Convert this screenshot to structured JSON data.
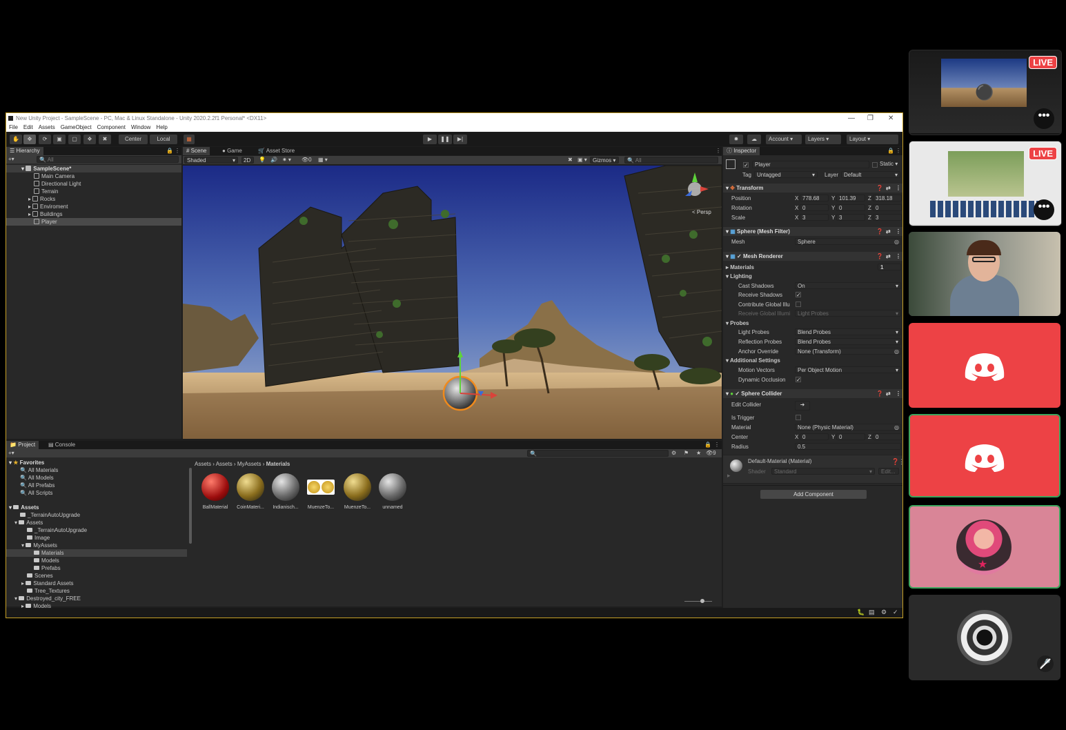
{
  "window": {
    "title": "New Unity Project - SampleScene - PC, Mac & Linux Standalone - Unity 2020.2.2f1 Personal* <DX11>",
    "menu": [
      "File",
      "Edit",
      "Assets",
      "GameObject",
      "Component",
      "Window",
      "Help"
    ]
  },
  "toolbar": {
    "pivot": "Center",
    "space": "Local",
    "account": "Account",
    "layers": "Layers",
    "layout": "Layout"
  },
  "hierarchy": {
    "tab": "Hierarchy",
    "search_placeholder": "All",
    "scene": "SampleScene*",
    "items": [
      "Main Camera",
      "Directional Light",
      "Terrain",
      "Rocks",
      "Enviroment",
      "Buildings",
      "Player"
    ]
  },
  "scene_view": {
    "tabs": [
      "Scene",
      "Game",
      "Asset Store"
    ],
    "shading": "Shaded",
    "mode_2d": "2D",
    "hidden_count": "0",
    "gizmos": "Gizmos",
    "search_placeholder": "All",
    "persp": "< Persp"
  },
  "project": {
    "tabs": [
      "Project",
      "Console"
    ],
    "favorites_label": "Favorites",
    "favorites": [
      "All Materials",
      "All Models",
      "All Prefabs",
      "All Scripts"
    ],
    "assets_root": "Assets",
    "tree": [
      "_TerrainAutoUpgrade",
      "Assets",
      "_TerrainAutoUpgrade",
      "Image",
      "MyAssets",
      "Materials",
      "Models",
      "Prefabs",
      "Scenes",
      "Standard Assets",
      "Tree_Textures",
      "Destroyed_city_FREE",
      "Models"
    ],
    "breadcrumb": [
      "Assets",
      "Assets",
      "MyAssets",
      "Materials"
    ],
    "hidden_count": "9",
    "materials": [
      "BallMaterial",
      "CoinMateri...",
      "Indianisch...",
      "MuenzeTo...",
      "MuenzeTo...",
      "unnamed"
    ]
  },
  "inspector": {
    "tab": "Inspector",
    "object_name": "Player",
    "static_label": "Static",
    "tag_label": "Tag",
    "tag_value": "Untagged",
    "layer_label": "Layer",
    "layer_value": "Default",
    "transform": {
      "title": "Transform",
      "position_label": "Position",
      "rotation_label": "Rotation",
      "scale_label": "Scale",
      "position": [
        "778.68",
        "101.39",
        "318.18"
      ],
      "rotation": [
        "0",
        "0",
        "0"
      ],
      "scale": [
        "3",
        "3",
        "3"
      ]
    },
    "mesh_filter": {
      "title": "Sphere (Mesh Filter)",
      "mesh_label": "Mesh",
      "mesh_value": "Sphere"
    },
    "mesh_renderer": {
      "title": "Mesh Renderer",
      "materials_label": "Materials",
      "materials_count": "1",
      "lighting_label": "Lighting",
      "cast_shadows_label": "Cast Shadows",
      "cast_shadows_value": "On",
      "receive_shadows_label": "Receive Shadows",
      "contribute_gi_label": "Contribute Global Illu",
      "receive_gi_label": "Receive Global Illumi",
      "receive_gi_value": "Light Probes",
      "probes_label": "Probes",
      "light_probes_label": "Light Probes",
      "light_probes_value": "Blend Probes",
      "reflection_probes_label": "Reflection Probes",
      "reflection_probes_value": "Blend Probes",
      "anchor_override_label": "Anchor Override",
      "anchor_override_value": "None (Transform)",
      "additional_label": "Additional Settings",
      "motion_vectors_label": "Motion Vectors",
      "motion_vectors_value": "Per Object Motion",
      "dynamic_occlusion_label": "Dynamic Occlusion"
    },
    "sphere_collider": {
      "title": "Sphere Collider",
      "edit_collider_label": "Edit Collider",
      "is_trigger_label": "Is Trigger",
      "material_label": "Material",
      "material_value": "None (Physic Material)",
      "center_label": "Center",
      "center": [
        "0",
        "0",
        "0"
      ],
      "radius_label": "Radius",
      "radius": "0.5"
    },
    "material": {
      "title": "Default-Material (Material)",
      "shader_label": "Shader",
      "shader_value": "Standard",
      "edit_label": "Edit..."
    },
    "add_component": "Add Component"
  },
  "sidebar": {
    "live_label": "LIVE",
    "more_label": "•••",
    "colors": {
      "discord_red": "#ed4245",
      "pink": "#d98597",
      "live_red": "#ed4245"
    }
  }
}
